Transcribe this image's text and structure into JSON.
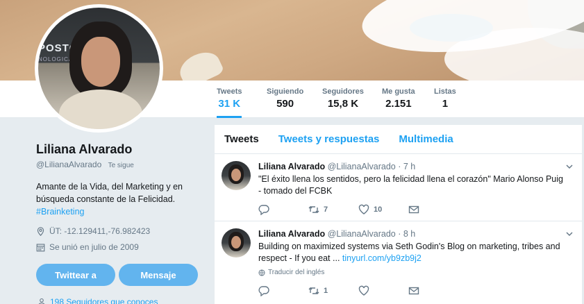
{
  "profile": {
    "name": "Liliana Alvarado",
    "handle": "@LilianaAlvarado",
    "follows_you": "Te sigue",
    "bio_line": "Amante de la Vida, del Marketing y en búsqueda constante de la Felicidad.",
    "bio_hashtag": "#Brainketing",
    "location": "ÜT: -12.129411,-76.982423",
    "joined": "Se unió en julio de 2009",
    "tweet_button": "Twittear a",
    "message_button": "Mensaje",
    "followers_you_know": "198 Seguidores que conoces",
    "avatar_sign": "POSTGR",
    "avatar_sign2": "NOLOGICA"
  },
  "stats": [
    {
      "label": "Tweets",
      "value": "31 K"
    },
    {
      "label": "Siguiendo",
      "value": "590"
    },
    {
      "label": "Seguidores",
      "value": "15,8 K"
    },
    {
      "label": "Me gusta",
      "value": "2.151"
    },
    {
      "label": "Listas",
      "value": "1"
    }
  ],
  "tabs": [
    "Tweets",
    "Tweets y respuestas",
    "Multimedia"
  ],
  "tweets": [
    {
      "name": "Liliana Alvarado",
      "meta": "@LilianaAlvarado · 7 h",
      "text": "\"El éxito llena los sentidos, pero la felicidad llena el corazón\" Mario Alonso Puig - tomado del FCBK",
      "link": "",
      "translate": "",
      "reply_count": "",
      "retweets": "7",
      "likes": "10"
    },
    {
      "name": "Liliana Alvarado",
      "meta": "@LilianaAlvarado · 8 h",
      "text": "Building on maximized systems via Seth Godin's Blog on marketing, tribes and respect - If you eat ... ",
      "link": "tinyurl.com/yb9zb9j2",
      "translate": "Traducir del inglés",
      "reply_count": "",
      "retweets": "1",
      "likes": ""
    }
  ],
  "colors": {
    "accent": "#1da1f2",
    "button": "#62b4ee",
    "background": "#e6ecf0"
  }
}
